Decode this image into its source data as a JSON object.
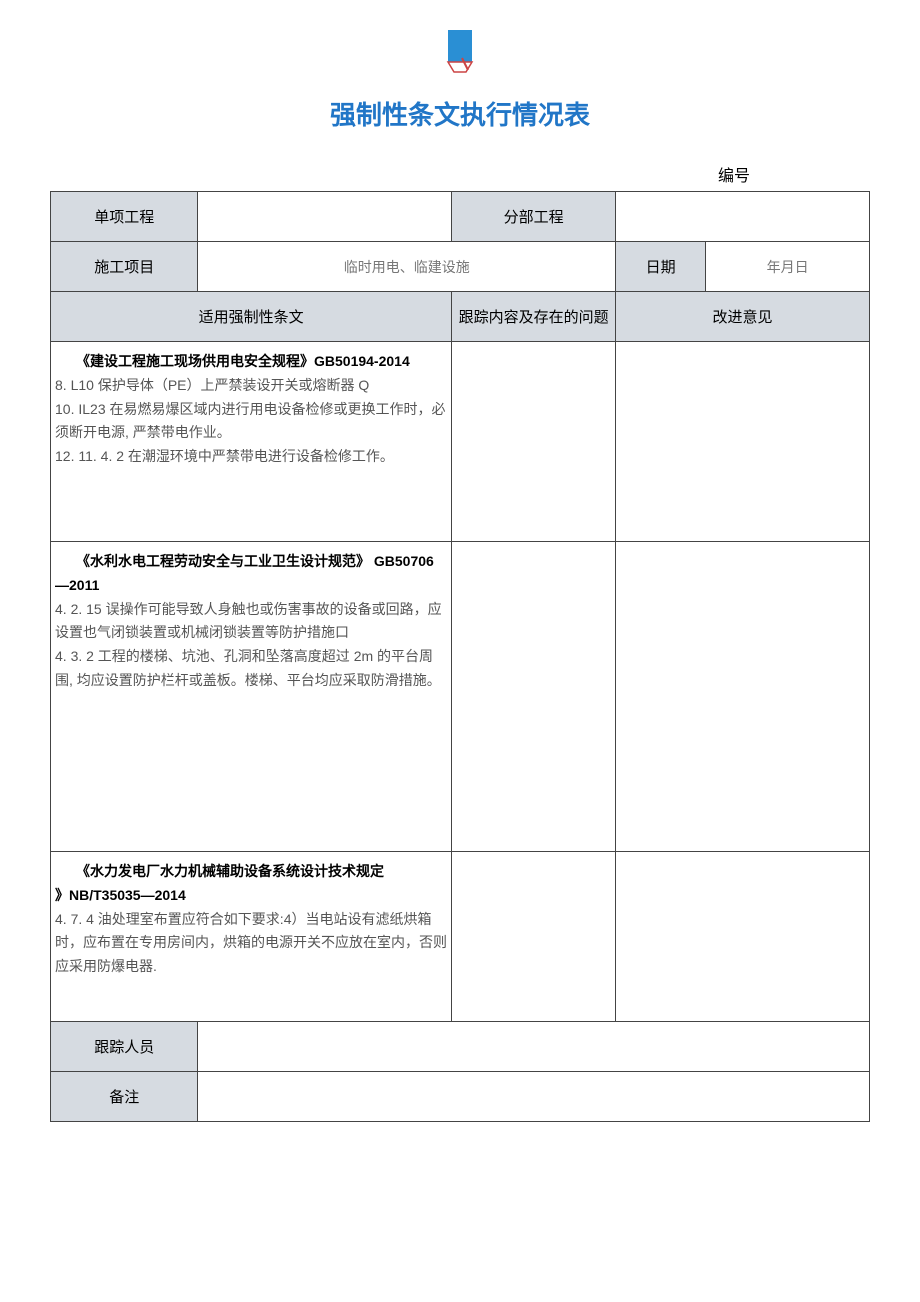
{
  "title": "强制性条文执行情况表",
  "form_id_label": "编号",
  "headers": {
    "single_project": "单项工程",
    "sub_project": "分部工程",
    "construction_item": "施工项目",
    "construction_item_value": "临时用电、临建设施",
    "date_label": "日期",
    "date_value": "年月日",
    "applicable": "适用强制性条文",
    "tracking": "跟踪内容及存在的问题",
    "improvement": "改进意见",
    "tracker": "跟踪人员",
    "remark": "备注"
  },
  "rows": [
    {
      "spec_title": "《建设工程施工现场供用电安全规程》GB50194-2014",
      "spec_body": "8. L10 保护导体（PE）上严禁装设开关或熔断器 Q\n10. IL23 在易燃易爆区域内进行用电设备检修或更换工作时，必须断开电源, 严禁带电作业。\n12. 11. 4. 2 在潮湿环境中严禁带电进行设备检修工作。"
    },
    {
      "spec_title": "《水利水电工程劳动安全与工业卫生设计规范》 GB50706—2011",
      "spec_body": "4. 2. 15 误操作可能导致人身触也或伤害事故的设备或回路，应设置也气闭锁装置或机械闭锁装置等防护措施口\n4. 3. 2 工程的楼梯、坑池、孔洞和坠落高度超过 2m 的平台周围, 均应设置防护栏杆或盖板。楼梯、平台均应采取防滑措施。"
    },
    {
      "spec_title": "《水力发电厂水力机械辅助设备系统设计技术规定\n》NB/T35035—2014",
      "spec_body": "4. 7. 4 油处理室布置应符合如下要求:4）当电站设有滤纸烘箱时，应布置在专用房间内，烘箱的电源开关不应放在室内，否则应采用防爆电器."
    }
  ]
}
